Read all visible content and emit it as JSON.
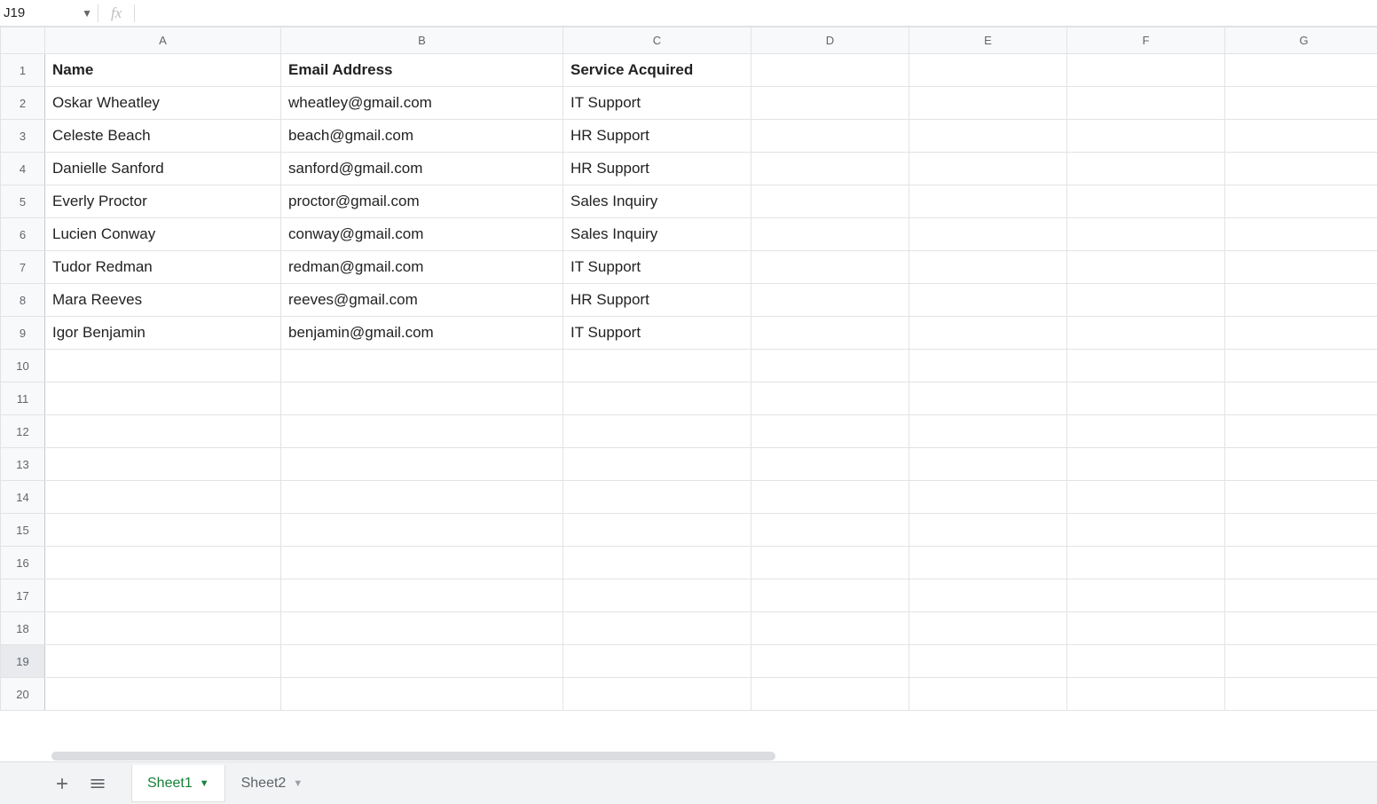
{
  "nameBox": "J19",
  "fxLabel": "fx",
  "columns": [
    "A",
    "B",
    "C",
    "D",
    "E",
    "F",
    "G"
  ],
  "rowCount": 20,
  "selectedRow": 19,
  "headers": {
    "A": "Name",
    "B": "Email Address",
    "C": "Service Acquired"
  },
  "rows": [
    {
      "A": "Oskar Wheatley",
      "B": "wheatley@gmail.com",
      "C": "IT Support"
    },
    {
      "A": "Celeste Beach",
      "B": "beach@gmail.com",
      "C": "HR Support"
    },
    {
      "A": "Danielle Sanford",
      "B": "sanford@gmail.com",
      "C": "HR Support"
    },
    {
      "A": "Everly Proctor",
      "B": "proctor@gmail.com",
      "C": "Sales Inquiry"
    },
    {
      "A": "Lucien Conway",
      "B": "conway@gmail.com",
      "C": "Sales Inquiry"
    },
    {
      "A": "Tudor Redman",
      "B": "redman@gmail.com",
      "C": "IT Support"
    },
    {
      "A": "Mara Reeves",
      "B": "reeves@gmail.com",
      "C": "HR Support"
    },
    {
      "A": "Igor Benjamin",
      "B": "benjamin@gmail.com",
      "C": "IT Support"
    }
  ],
  "tabs": [
    {
      "label": "Sheet1",
      "active": true
    },
    {
      "label": "Sheet2",
      "active": false
    }
  ],
  "addSheetTitle": "Add sheet",
  "allSheetsTitle": "All sheets"
}
